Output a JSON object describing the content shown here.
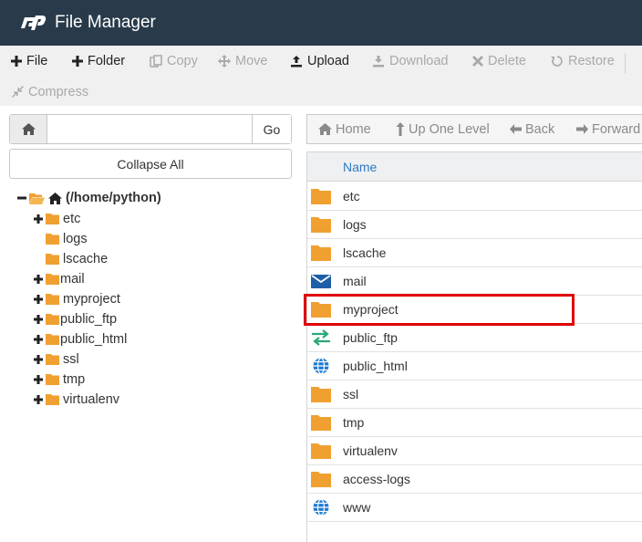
{
  "header": {
    "title": "File Manager",
    "logo_icon": "cpanel-logo-icon",
    "bg_color": "#293a4a"
  },
  "toolbar": {
    "file_label": "File",
    "folder_label": "Folder",
    "copy_label": "Copy",
    "move_label": "Move",
    "upload_label": "Upload",
    "download_label": "Download",
    "delete_label": "Delete",
    "restore_label": "Restore",
    "compress_label": "Compress"
  },
  "path_bar": {
    "home_icon": "home-icon",
    "path_value": "",
    "go_label": "Go"
  },
  "collapse_all_label": "Collapse All",
  "tree": {
    "root_label": "(/home/python)",
    "items": [
      {
        "label": "etc",
        "expandable": true
      },
      {
        "label": "logs",
        "expandable": false
      },
      {
        "label": "lscache",
        "expandable": false
      },
      {
        "label": "mail",
        "expandable": true
      },
      {
        "label": "myproject",
        "expandable": true
      },
      {
        "label": "public_ftp",
        "expandable": true
      },
      {
        "label": "public_html",
        "expandable": true
      },
      {
        "label": "ssl",
        "expandable": true
      },
      {
        "label": "tmp",
        "expandable": true
      },
      {
        "label": "virtualenv",
        "expandable": true
      }
    ]
  },
  "nav": {
    "home_label": "Home",
    "up_label": "Up One Level",
    "back_label": "Back",
    "forward_label": "Forward"
  },
  "files": {
    "column_name": "Name",
    "rows": [
      {
        "name": "etc",
        "icon": "folder-icon"
      },
      {
        "name": "logs",
        "icon": "folder-icon"
      },
      {
        "name": "lscache",
        "icon": "folder-icon"
      },
      {
        "name": "mail",
        "icon": "mail-icon"
      },
      {
        "name": "myproject",
        "icon": "folder-icon"
      },
      {
        "name": "public_ftp",
        "icon": "transfer-icon"
      },
      {
        "name": "public_html",
        "icon": "globe-icon"
      },
      {
        "name": "ssl",
        "icon": "folder-icon"
      },
      {
        "name": "tmp",
        "icon": "folder-icon"
      },
      {
        "name": "virtualenv",
        "icon": "folder-icon"
      },
      {
        "name": "access-logs",
        "icon": "folder-icon"
      },
      {
        "name": "www",
        "icon": "globe-icon"
      }
    ],
    "highlighted_row": "myproject"
  },
  "colors": {
    "folder": "#f0a030",
    "highlight": "#e00000",
    "link_blue": "#2f7bbf",
    "mail_blue": "#1e5ea8",
    "transfer_green": "#2aa876"
  }
}
